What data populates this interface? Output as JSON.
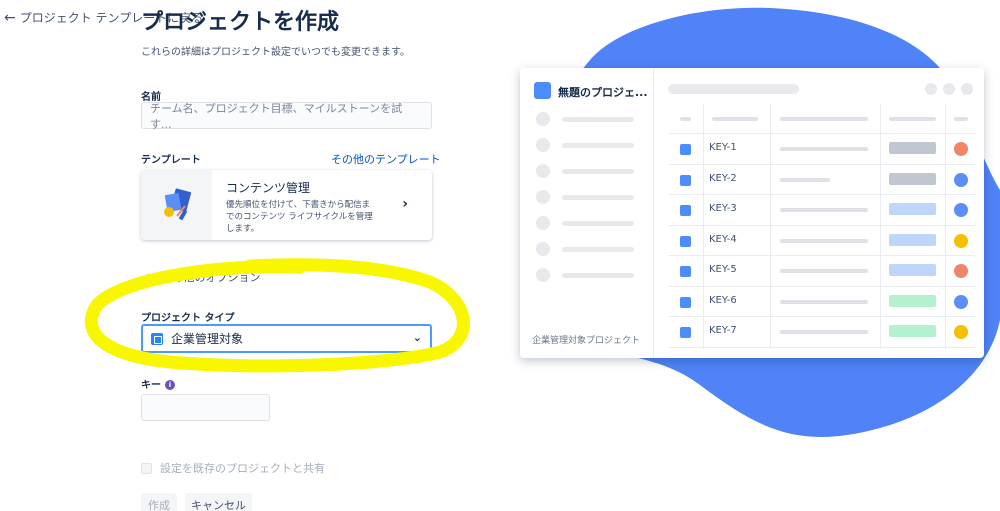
{
  "header": {
    "back_label": "プロジェクト テンプレートに戻る",
    "title": "プロジェクトを作成",
    "subtitle": "これらの詳細はプロジェクト設定でいつでも変更できます。"
  },
  "form": {
    "name_label": "名前",
    "name_placeholder": "チーム名、プロジェクト目標、マイルストーンを試す...",
    "template_label": "テンプレート",
    "more_templates_link": "その他のテンプレート",
    "template": {
      "name": "コンテンツ管理",
      "description": "優先順位を付けて、下書きから配信までのコンテンツ ライフサイクルを管理します。"
    },
    "more_options_label": "その他のオプション",
    "project_type_label": "プロジェクト タイプ",
    "project_type_value": "企業管理対象",
    "key_label": "キー",
    "key_value": "",
    "share_settings_label": "設定を既存のプロジェクトと共有",
    "create_button": "作成",
    "cancel_button": "キャンセル"
  },
  "preview": {
    "project_name": "無題のプロジェ...",
    "footer_label": "企業管理対象プロジェクト",
    "rows": [
      {
        "key": "KEY-1",
        "status_color": "#c1c7d0",
        "avatar_color": "#f0856a"
      },
      {
        "key": "KEY-2",
        "status_color": "#c1c7d0",
        "avatar_color": "#5b8ef7"
      },
      {
        "key": "KEY-3",
        "status_color": "#bfd6fb",
        "avatar_color": "#5b8ef7"
      },
      {
        "key": "KEY-4",
        "status_color": "#bfd6fb",
        "avatar_color": "#f5c000"
      },
      {
        "key": "KEY-5",
        "status_color": "#bfd6fb",
        "avatar_color": "#f0856a"
      },
      {
        "key": "KEY-6",
        "status_color": "#b3f1cf",
        "avatar_color": "#5b8ef7"
      },
      {
        "key": "KEY-7",
        "status_color": "#b3f1cf",
        "avatar_color": "#f5c000"
      }
    ]
  },
  "colors": {
    "blob": "#4f83f7",
    "highlight": "#f8f700",
    "link": "#0052cc",
    "focus_border": "#4c9aff"
  },
  "icons": {
    "back": "arrow-left-icon",
    "chevron_right": "chevron-right-icon",
    "chevron_down": "chevron-down-icon",
    "info": "info-icon"
  }
}
